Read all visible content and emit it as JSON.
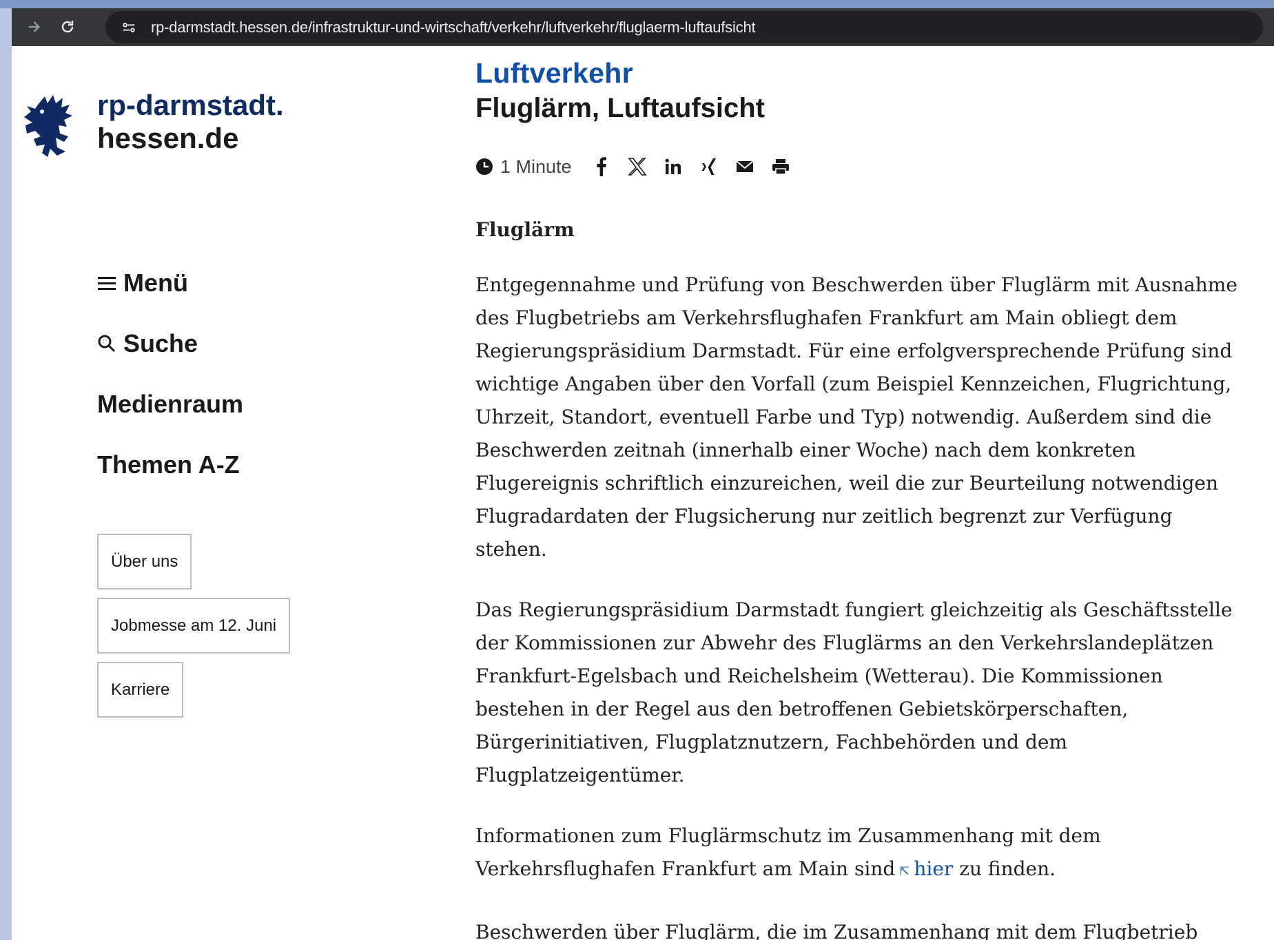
{
  "browser": {
    "url": "rp-darmstadt.hessen.de/infrastruktur-und-wirtschaft/verkehr/luftverkehr/fluglaerm-luftaufsicht"
  },
  "logo": {
    "line1": "rp-darmstadt.",
    "line2": "hessen.de",
    "colors": {
      "primary": "#0f2a63"
    }
  },
  "sidenav": {
    "menu": "Menü",
    "search": "Suche",
    "media": "Medienraum",
    "topics": "Themen A-Z"
  },
  "quicklinks": [
    "Über uns",
    "Jobmesse am 12. Juni",
    "Karriere"
  ],
  "header": {
    "section": "Luftverkehr",
    "title": "Fluglärm, Luftaufsicht",
    "reading_time": "1 Minute"
  },
  "share_icons": [
    "facebook-icon",
    "x-icon",
    "linkedin-icon",
    "xing-icon",
    "mail-icon",
    "print-icon"
  ],
  "article": {
    "heading": "Fluglärm",
    "p1": "Entgegennahme und Prüfung von Beschwerden über Fluglärm mit Ausnahme des Flugbetriebs am Verkehrsflughafen Frankfurt am Main obliegt dem Regierungspräsidium Darmstadt. Für eine erfolgversprechende Prüfung sind wichtige Angaben über den Vorfall (zum Beispiel Kennzeichen, Flugrichtung, Uhrzeit, Standort, eventuell Farbe und Typ) notwendig. Außerdem sind die Beschwerden zeitnah (innerhalb einer Woche) nach dem konkreten Flugereignis schriftlich einzureichen, weil die zur Beurteilung notwendigen Flugradardaten der Flugsicherung nur zeitlich begrenzt zur Verfügung stehen.",
    "p2": "Das Regierungspräsidium Darmstadt fungiert gleichzeitig als Geschäftsstelle der Kommissionen zur Abwehr des Fluglärms an den Verkehrslandeplätzen Frankfurt-Egelsbach und Reichelsheim (Wetterau). Die Kommissionen bestehen in der Regel aus den betroffenen Gebietskörperschaften, Bürgerinitiativen, Flugplatznutzern, Fachbehörden und dem Flugplatzeigentümer.",
    "p3_before": "Informationen zum Fluglärmschutz im Zusammenhang mit dem Verkehrsflughafen Frankfurt am Main sind",
    "p3_link": "hier",
    "p3_after": "zu finden.",
    "p4": "Beschwerden über Fluglärm, die im Zusammenhang mit dem Flugbetrieb"
  }
}
